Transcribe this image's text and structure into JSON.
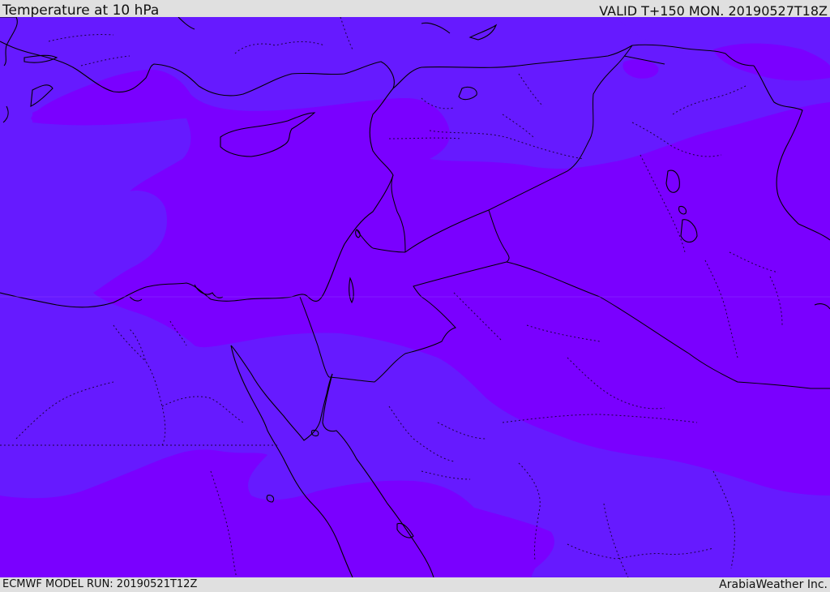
{
  "header": {
    "title": "Temperature at 10 hPa",
    "valid": "VALID T+150 MON. 20190527T18Z"
  },
  "footer": {
    "model_run": "ECMWF MODEL RUN: 20190521T12Z",
    "credit": "ArabiaWeather Inc."
  },
  "colors": {
    "band_cool": "#661aff",
    "band_warm": "#7a00ff",
    "coastline": "#000000",
    "border": "#000000",
    "bar_background": "#e0e0e0"
  }
}
